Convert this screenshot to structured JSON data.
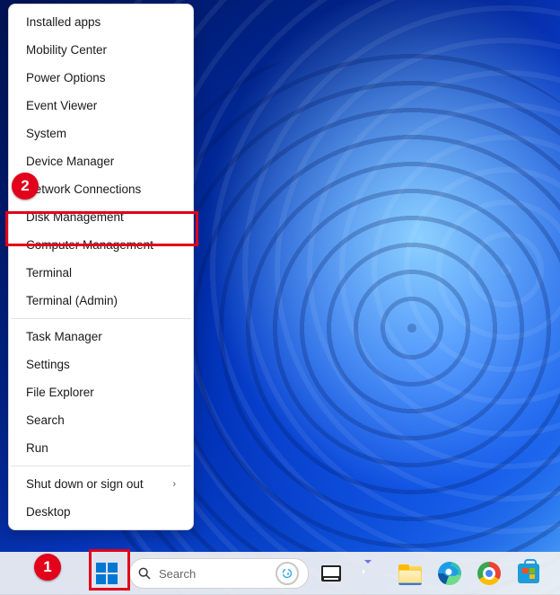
{
  "menu": {
    "groups": [
      [
        {
          "id": "installed-apps",
          "label": "Installed apps"
        },
        {
          "id": "mobility-center",
          "label": "Mobility Center"
        },
        {
          "id": "power-options",
          "label": "Power Options"
        },
        {
          "id": "event-viewer",
          "label": "Event Viewer"
        },
        {
          "id": "system",
          "label": "System"
        },
        {
          "id": "device-manager",
          "label": "Device Manager"
        },
        {
          "id": "network-connections",
          "label": "Network Connections"
        },
        {
          "id": "disk-management",
          "label": "Disk Management"
        },
        {
          "id": "computer-management",
          "label": "Computer Management"
        },
        {
          "id": "terminal",
          "label": "Terminal"
        },
        {
          "id": "terminal-admin",
          "label": "Terminal (Admin)"
        }
      ],
      [
        {
          "id": "task-manager",
          "label": "Task Manager"
        },
        {
          "id": "settings",
          "label": "Settings"
        },
        {
          "id": "file-explorer",
          "label": "File Explorer"
        },
        {
          "id": "search",
          "label": "Search"
        },
        {
          "id": "run",
          "label": "Run"
        }
      ],
      [
        {
          "id": "shut-down",
          "label": "Shut down or sign out",
          "submenu": true
        },
        {
          "id": "desktop",
          "label": "Desktop"
        }
      ]
    ]
  },
  "annotations": {
    "marker1": "1",
    "marker2": "2",
    "highlight_menu_item_id": "disk-management",
    "highlight_taskbar_item": "start-button"
  },
  "taskbar": {
    "search_placeholder": "Search",
    "items": [
      {
        "id": "start-button",
        "name": "start-button",
        "icon": "windows-start-icon"
      },
      {
        "id": "search",
        "name": "search-box",
        "icon": "search-icon"
      },
      {
        "id": "task-view",
        "name": "task-view-button",
        "icon": "task-view-icon"
      },
      {
        "id": "chat",
        "name": "chat-button",
        "icon": "chat-icon"
      },
      {
        "id": "file-explorer",
        "name": "file-explorer-button",
        "icon": "folder-icon"
      },
      {
        "id": "edge",
        "name": "edge-button",
        "icon": "edge-icon"
      },
      {
        "id": "chrome",
        "name": "chrome-button",
        "icon": "chrome-icon"
      },
      {
        "id": "store",
        "name": "microsoft-store-button",
        "icon": "store-icon"
      }
    ]
  },
  "colors": {
    "annotation_red": "#e2001a",
    "win_blue": "#0078d4"
  }
}
